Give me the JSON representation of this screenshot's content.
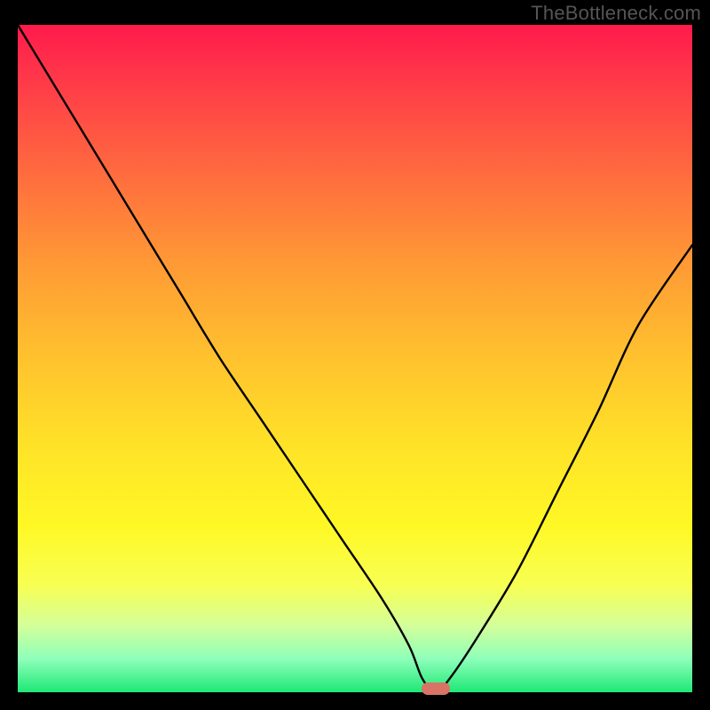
{
  "watermark": "TheBottleneck.com",
  "colors": {
    "frame_background": "#000000",
    "curve_stroke": "#000000",
    "marker_fill": "#d97366",
    "watermark_text": "#555555",
    "gradient_top": "#ff1a4b",
    "gradient_bottom": "#1fe876"
  },
  "chart_data": {
    "type": "line",
    "title": "",
    "xlabel": "",
    "ylabel": "",
    "xlim": [
      0,
      100
    ],
    "ylim": [
      0,
      100
    ],
    "y_axis_inverted_visual": true,
    "grid": false,
    "series": [
      {
        "name": "bottleneck-curve",
        "x": [
          0,
          6,
          12,
          18,
          24,
          30,
          36,
          42,
          48,
          54,
          58,
          60,
          62,
          64,
          68,
          74,
          80,
          86,
          92,
          100
        ],
        "values": [
          100,
          90,
          80,
          70,
          60,
          50,
          41,
          32,
          23,
          14,
          7,
          2,
          0,
          2,
          8,
          18,
          30,
          42,
          55,
          67
        ]
      }
    ],
    "annotations": [
      {
        "name": "optimal-marker",
        "x": 62,
        "y": 0.5
      }
    ],
    "description": "Asymmetric V-shaped curve over a vertical rainbow/heatmap gradient; y roughly encodes bottleneck percentage with minimum near x≈62."
  }
}
